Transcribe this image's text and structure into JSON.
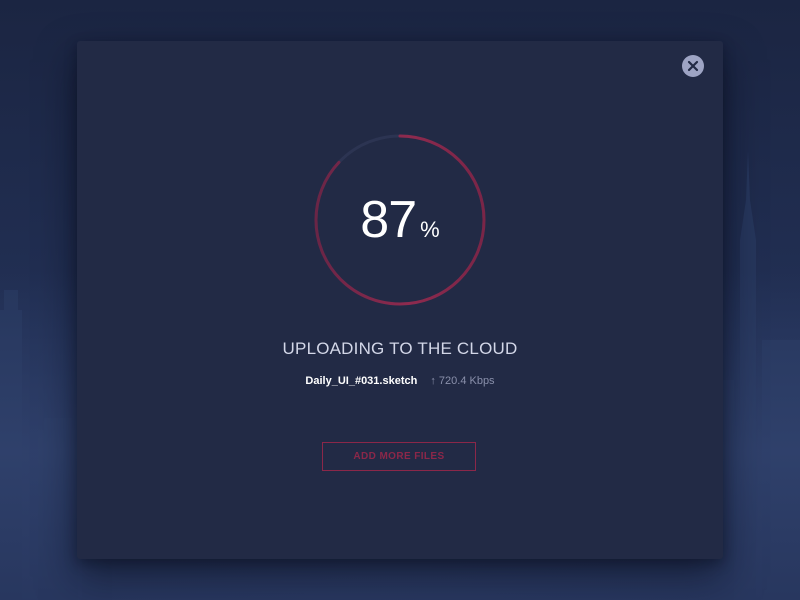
{
  "upload": {
    "progress_percent": 87,
    "percent_value": "87",
    "percent_unit": "%",
    "status": "UPLOADING TO THE CLOUD",
    "file_name": "Daily_UI_#031.sketch",
    "speed": "720.4 Kbps"
  },
  "actions": {
    "add_more_label": "ADD MORE FILES"
  },
  "icons": {
    "close": "close-icon",
    "upload_arrow": "arrow-up-icon"
  },
  "colors": {
    "modal_bg": "#222a45",
    "accent": "#8b2749",
    "ring_track": "#2c3452",
    "close_button": "#9ea4c4"
  }
}
